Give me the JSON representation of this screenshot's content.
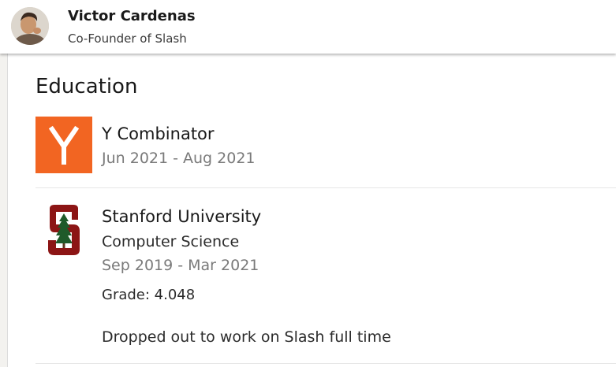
{
  "header": {
    "name": "Victor Cardenas",
    "headline": "Co-Founder of Slash"
  },
  "education": {
    "title": "Education",
    "entries": [
      {
        "school": "Y Combinator",
        "dates": "Jun 2021 - Aug 2021",
        "logo_letter": "Y",
        "logo_color": "#f26522"
      },
      {
        "school": "Stanford University",
        "field": "Computer Science",
        "dates": "Sep 2019 - Mar 2021",
        "grade": "Grade: 4.048",
        "description": "Dropped out to work on Slash full time",
        "logo_color": "#8c1515"
      }
    ]
  }
}
